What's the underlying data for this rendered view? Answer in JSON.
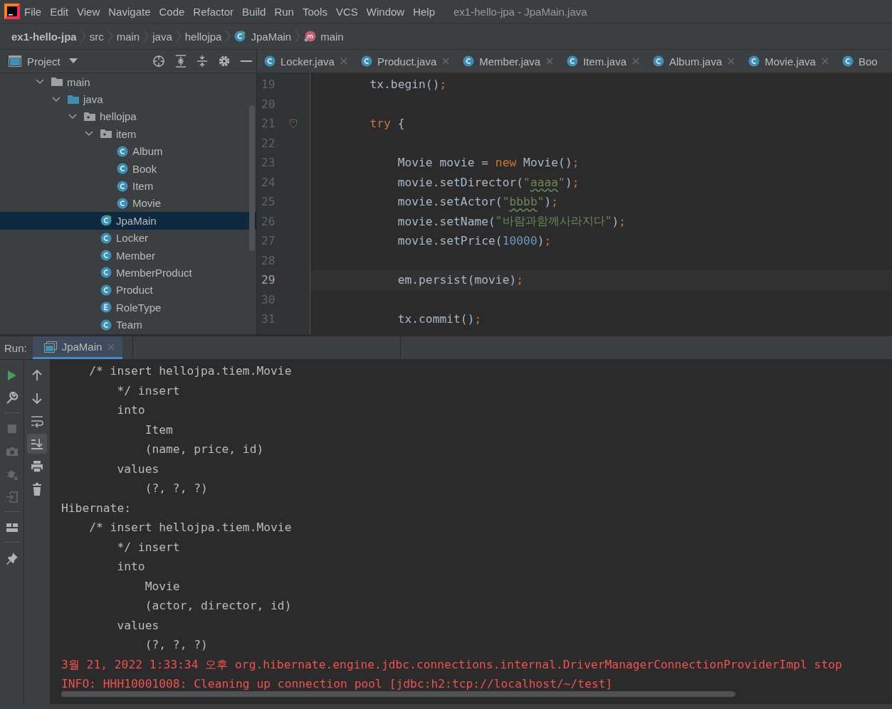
{
  "window": {
    "title": "ex1-hello-jpa - JpaMain.java"
  },
  "menu": [
    "File",
    "Edit",
    "View",
    "Navigate",
    "Code",
    "Refactor",
    "Build",
    "Run",
    "Tools",
    "VCS",
    "Window",
    "Help"
  ],
  "breadcrumb": [
    {
      "label": "ex1-hello-jpa",
      "kind": "project"
    },
    {
      "label": "src",
      "kind": "folder"
    },
    {
      "label": "main",
      "kind": "folder"
    },
    {
      "label": "java",
      "kind": "folder"
    },
    {
      "label": "hellojpa",
      "kind": "folder"
    },
    {
      "label": "JpaMain",
      "kind": "class"
    },
    {
      "label": "main",
      "kind": "method"
    }
  ],
  "project_panel": {
    "title": "Project",
    "tree": [
      {
        "label": "main",
        "kind": "folder",
        "expanded": true,
        "selected": false,
        "children": [
          {
            "label": "java",
            "kind": "source-folder",
            "expanded": true,
            "selected": false,
            "children": [
              {
                "label": "hellojpa",
                "kind": "package",
                "expanded": true,
                "selected": false,
                "children": [
                  {
                    "label": "item",
                    "kind": "package",
                    "expanded": true,
                    "selected": false,
                    "children": [
                      {
                        "label": "Album",
                        "kind": "class",
                        "selected": false
                      },
                      {
                        "label": "Book",
                        "kind": "class",
                        "selected": false
                      },
                      {
                        "label": "Item",
                        "kind": "class",
                        "selected": false
                      },
                      {
                        "label": "Movie",
                        "kind": "class",
                        "selected": false
                      }
                    ]
                  },
                  {
                    "label": "JpaMain",
                    "kind": "main-class",
                    "selected": true
                  },
                  {
                    "label": "Locker",
                    "kind": "class",
                    "selected": false
                  },
                  {
                    "label": "Member",
                    "kind": "class",
                    "selected": false
                  },
                  {
                    "label": "MemberProduct",
                    "kind": "class",
                    "selected": false
                  },
                  {
                    "label": "Product",
                    "kind": "class",
                    "selected": false
                  },
                  {
                    "label": "RoleType",
                    "kind": "enum",
                    "selected": false
                  },
                  {
                    "label": "Team",
                    "kind": "class",
                    "selected": false
                  }
                ]
              }
            ]
          }
        ]
      }
    ]
  },
  "editor": {
    "tabs": [
      {
        "label": "Locker.java",
        "closable": true
      },
      {
        "label": "Product.java",
        "closable": true
      },
      {
        "label": "Member.java",
        "closable": true
      },
      {
        "label": "Item.java",
        "closable": true
      },
      {
        "label": "Album.java",
        "closable": true
      },
      {
        "label": "Movie.java",
        "closable": true
      },
      {
        "label": "Boo",
        "closable": false
      }
    ],
    "lines": [
      {
        "number": "19",
        "current": false,
        "fold": false,
        "tokens": [
          {
            "kind": "plain",
            "text": "        tx.begin()"
          },
          {
            "kind": "punct",
            "text": ";"
          }
        ]
      },
      {
        "number": "20",
        "current": false,
        "fold": false
      },
      {
        "number": "21",
        "current": false,
        "fold": true,
        "tokens": [
          {
            "kind": "keyword",
            "text": "        try"
          },
          {
            "kind": "plain",
            "text": " {"
          }
        ]
      },
      {
        "number": "22",
        "current": false,
        "fold": false
      },
      {
        "number": "23",
        "current": false,
        "fold": false,
        "tokens": [
          {
            "kind": "plain",
            "text": "            Movie movie = "
          },
          {
            "kind": "keyword",
            "text": "new"
          },
          {
            "kind": "plain",
            "text": " Movie()"
          },
          {
            "kind": "punct",
            "text": ";"
          }
        ]
      },
      {
        "number": "24",
        "current": false,
        "fold": false,
        "tokens": [
          {
            "kind": "plain",
            "text": "            movie.setDirector("
          },
          {
            "kind": "string",
            "text": "\""
          },
          {
            "kind": "typo-string",
            "text": "aaaa"
          },
          {
            "kind": "string",
            "text": "\""
          },
          {
            "kind": "plain",
            "text": ")"
          },
          {
            "kind": "punct",
            "text": ";"
          }
        ]
      },
      {
        "number": "25",
        "current": false,
        "fold": false,
        "tokens": [
          {
            "kind": "plain",
            "text": "            movie.setActor("
          },
          {
            "kind": "string",
            "text": "\""
          },
          {
            "kind": "typo-string",
            "text": "bbbb"
          },
          {
            "kind": "string",
            "text": "\""
          },
          {
            "kind": "plain",
            "text": ")"
          },
          {
            "kind": "punct",
            "text": ";"
          }
        ]
      },
      {
        "number": "26",
        "current": false,
        "fold": false,
        "tokens": [
          {
            "kind": "plain",
            "text": "            movie.setName("
          },
          {
            "kind": "string",
            "text": "\"바람과함께사라지다\""
          },
          {
            "kind": "plain",
            "text": ")"
          },
          {
            "kind": "punct",
            "text": ";"
          }
        ]
      },
      {
        "number": "27",
        "current": false,
        "fold": false,
        "tokens": [
          {
            "kind": "plain",
            "text": "            movie.setPrice("
          },
          {
            "kind": "number",
            "text": "10000"
          },
          {
            "kind": "plain",
            "text": ")"
          },
          {
            "kind": "punct",
            "text": ";"
          }
        ]
      },
      {
        "number": "28",
        "current": false,
        "fold": false
      },
      {
        "number": "29",
        "current": true,
        "fold": false,
        "tokens": [
          {
            "kind": "plain",
            "text": "            em.persist(movie)"
          },
          {
            "kind": "punct",
            "text": ";"
          }
        ]
      },
      {
        "number": "30",
        "current": false,
        "fold": false
      },
      {
        "number": "31",
        "current": false,
        "fold": false,
        "tokens": [
          {
            "kind": "plain",
            "text": "            tx.commit()"
          },
          {
            "kind": "punct",
            "text": ";"
          }
        ]
      }
    ]
  },
  "run_panel": {
    "label": "Run:",
    "tabs": [
      {
        "label": "JpaMain",
        "selected": true
      }
    ],
    "left_tools": [
      {
        "kind": "run",
        "disabled": false
      },
      {
        "kind": "settings",
        "disabled": false
      },
      {
        "kind": "stop",
        "disabled": true
      },
      {
        "kind": "camera",
        "disabled": true
      },
      {
        "kind": "debug",
        "disabled": true
      },
      {
        "kind": "import",
        "disabled": true
      },
      {
        "kind": "layout",
        "disabled": false
      },
      {
        "kind": "pin",
        "disabled": false
      }
    ],
    "right_tools": [
      {
        "kind": "up",
        "on": false
      },
      {
        "kind": "down",
        "on": false
      },
      {
        "kind": "wrap",
        "on": false
      },
      {
        "kind": "scroll-end",
        "on": true
      },
      {
        "kind": "print",
        "on": false
      },
      {
        "kind": "delete",
        "on": false
      }
    ],
    "console": [
      {
        "kind": "plain",
        "text": "    /* insert hellojpa.tiem.Movie"
      },
      {
        "kind": "plain",
        "text": "        */ insert"
      },
      {
        "kind": "plain",
        "text": "        into"
      },
      {
        "kind": "plain",
        "text": "            Item"
      },
      {
        "kind": "plain",
        "text": "            (name, price, id)"
      },
      {
        "kind": "plain",
        "text": "        values"
      },
      {
        "kind": "plain",
        "text": "            (?, ?, ?)"
      },
      {
        "kind": "plain",
        "text": "Hibernate:"
      },
      {
        "kind": "plain",
        "text": "    /* insert hellojpa.tiem.Movie"
      },
      {
        "kind": "plain",
        "text": "        */ insert"
      },
      {
        "kind": "plain",
        "text": "        into"
      },
      {
        "kind": "plain",
        "text": "            Movie"
      },
      {
        "kind": "plain",
        "text": "            (actor, director, id)"
      },
      {
        "kind": "plain",
        "text": "        values"
      },
      {
        "kind": "plain",
        "text": "            (?, ?, ?)"
      },
      {
        "kind": "error",
        "text": "3월 21, 2022 1:33:34 오후 org.hibernate.engine.jdbc.connections.internal.DriverManagerConnectionProviderImpl stop"
      },
      {
        "kind": "error",
        "text": "INFO: HHH10001008: Cleaning up connection pool [jdbc:h2:tcp://localhost/~/test]"
      }
    ]
  }
}
